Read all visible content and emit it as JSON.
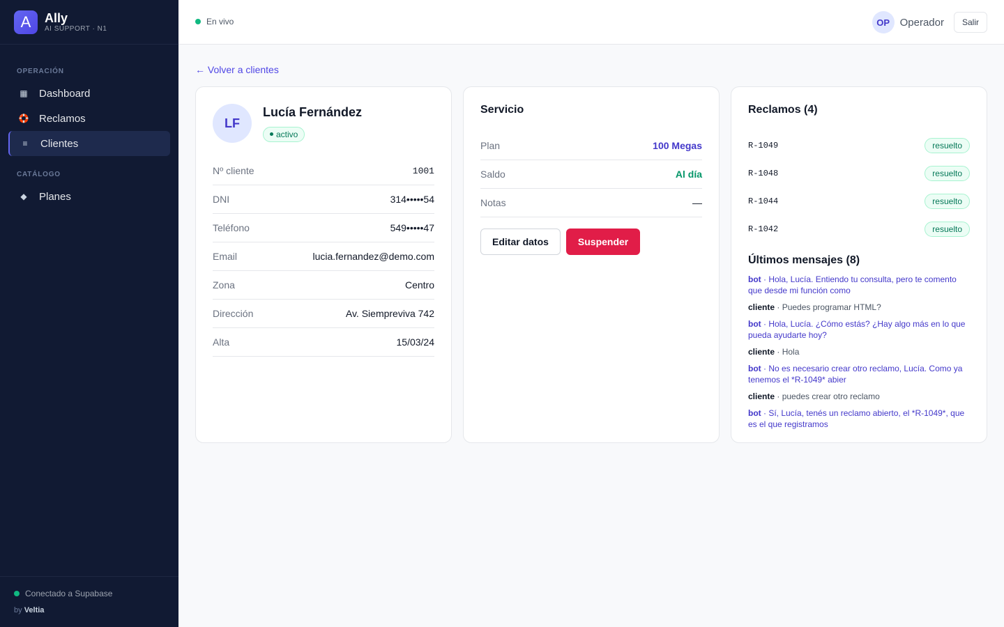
{
  "brand": {
    "logo_letter": "A",
    "name": "Ally",
    "subtitle": "AI SUPPORT · N1"
  },
  "sidebar": {
    "sections": [
      {
        "label": "OPERACIÓN"
      },
      {
        "label": "CATÁLOGO"
      }
    ],
    "items": [
      {
        "label": "Dashboard",
        "icon": "grid-icon",
        "glyph": "▦"
      },
      {
        "label": "Reclamos",
        "icon": "lifebuoy-icon",
        "glyph": "🛟"
      },
      {
        "label": "Clientes",
        "icon": "list-icon",
        "glyph": "≡",
        "active": true
      },
      {
        "label": "Planes",
        "icon": "diamond-icon",
        "glyph": "◆"
      }
    ],
    "footer": {
      "status": "Conectado a Supabase",
      "by_prefix": "by",
      "by_name": "Veltia"
    }
  },
  "topbar": {
    "live_label": "En vivo",
    "user_initials": "OP",
    "user_name": "Operador",
    "logout_label": "Salir"
  },
  "back_link": "← Volver a clientes",
  "customer": {
    "initials": "LF",
    "name": "Lucía Fernández",
    "status": "activo",
    "fields": [
      {
        "label": "Nº cliente",
        "value": "1001"
      },
      {
        "label": "DNI",
        "value": "314•••••54"
      },
      {
        "label": "Teléfono",
        "value": "549•••••47"
      },
      {
        "label": "Email",
        "value": "lucia.fernandez@demo.com"
      },
      {
        "label": "Zona",
        "value": "Centro"
      },
      {
        "label": "Dirección",
        "value": "Av. Siempreviva 742"
      },
      {
        "label": "Alta",
        "value": "15/03/24"
      }
    ]
  },
  "service": {
    "title": "Servicio",
    "rows": [
      {
        "label": "Plan",
        "value": "100 Megas"
      },
      {
        "label": "Saldo",
        "value": "Al día"
      },
      {
        "label": "Notas",
        "value": "—"
      }
    ],
    "edit_label": "Editar datos",
    "suspend_label": "Suspender"
  },
  "claims": {
    "title": "Reclamos (4)",
    "items": [
      {
        "id": "R-1049",
        "status": "resuelto"
      },
      {
        "id": "R-1048",
        "status": "resuelto"
      },
      {
        "id": "R-1044",
        "status": "resuelto"
      },
      {
        "id": "R-1042",
        "status": "resuelto"
      }
    ]
  },
  "messages": {
    "title": "Últimos mensajes (8)",
    "items": [
      {
        "from": "bot",
        "text": "Hola, Lucía. Entiendo tu consulta, pero te comento que desde mi función como"
      },
      {
        "from": "cliente",
        "text": "Puedes programar HTML?"
      },
      {
        "from": "bot",
        "text": "Hola, Lucía. ¿Cómo estás? ¿Hay algo más en lo que pueda ayudarte hoy?"
      },
      {
        "from": "cliente",
        "text": "Hola"
      },
      {
        "from": "bot",
        "text": "No es necesario crear otro reclamo, Lucía. Como ya tenemos el *R-1049* abier"
      },
      {
        "from": "cliente",
        "text": "puedes crear otro reclamo"
      },
      {
        "from": "bot",
        "text": "Sí, Lucía, tenés un reclamo abierto, el *R-1049*, que es el que registramos"
      }
    ]
  },
  "colors": {
    "accent": "#4f46e5",
    "sidebar_bg": "#111a33",
    "success": "#10b981",
    "danger": "#e11d48"
  }
}
